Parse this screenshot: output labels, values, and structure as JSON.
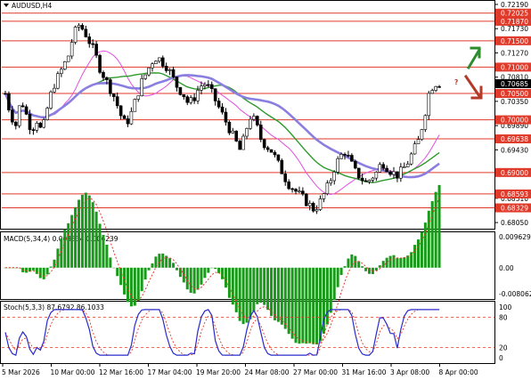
{
  "window": {
    "symbol_label": "AUDUSD,H4"
  },
  "main_panel": {
    "ylim": [
      0.6795,
      0.7224
    ],
    "price_axis_ticks": [
      "0.72190",
      "0.71730",
      "0.71270",
      "0.70810",
      "0.70350",
      "0.69890",
      "0.69430",
      "0.68970",
      "0.68510",
      "0.68050"
    ],
    "levels": [
      {
        "value": 0.72025,
        "label": "0.72025",
        "badge": true
      },
      {
        "value": 0.7187,
        "label": "0.71870",
        "badge": true
      },
      {
        "value": 0.715,
        "label": "0.71500",
        "badge": true
      },
      {
        "value": 0.71,
        "label": "0.71000",
        "badge": true
      },
      {
        "value": 0.705,
        "label": "0.70500",
        "badge": true
      },
      {
        "value": 0.7,
        "label": "0.70000",
        "badge": true
      },
      {
        "value": 0.69638,
        "label": "0.69638",
        "badge": true
      },
      {
        "value": 0.69,
        "label": "0.69000",
        "badge": true
      },
      {
        "value": 0.68593,
        "label": "0.68593",
        "badge": true
      },
      {
        "value": 0.68329,
        "label": "0.68329",
        "badge": true
      }
    ],
    "current_price": {
      "value": 0.70685,
      "label": "0.70685"
    },
    "forecast_marks": {
      "question_mark": "?",
      "up_arrow_color": "#2e8b2e",
      "down_arrow_color": "#b33a2a"
    }
  },
  "macd_panel": {
    "title": "MACD(5,34,4) 0.008834 0.006239",
    "ticks": [
      "0.009629",
      "0.00",
      "-0.008062"
    ],
    "ylim": [
      -0.0095,
      0.0105
    ]
  },
  "stoch_panel": {
    "title": "Stoch(5,3,3) 87.6792 86.1033",
    "ticks": [
      "100",
      "80",
      "20",
      "0"
    ],
    "levels": [
      80,
      20
    ]
  },
  "time_axis": {
    "labels": [
      "5 Mar 2026",
      "10 Mar 00:00",
      "12 Mar 16:00",
      "17 Mar 04:00",
      "19 Mar 20:00",
      "24 Mar 08:00",
      "27 Mar 00:00",
      "31 Mar 16:00",
      "3 Apr 08:00",
      "8 Apr 00:00"
    ]
  },
  "colors": {
    "bull_candle": "#ffffff",
    "bear_candle": "#000000",
    "level_line": "#e03a2a",
    "badge_bg": "#e03a2a",
    "current_badge_bg": "#000000",
    "ma_slow": "#8a7fe0",
    "ma_mid": "#2e9a2e",
    "ma_fast": "#e050e0",
    "macd_hist": "#1a9a1a",
    "macd_signal": "#e03a2a",
    "stoch_main": "#2b2bcc",
    "stoch_signal": "#e03a2a"
  },
  "chart_data": {
    "type": "candlestick",
    "title": "",
    "xlabel": "",
    "ylabel": "",
    "x_range": [
      "5 Mar 2026",
      "8 Apr 2026"
    ],
    "ylim": [
      0.6795,
      0.7224
    ],
    "close_path": [
      0.705,
      0.701,
      0.699,
      0.704,
      0.701,
      0.698,
      0.7,
      0.6975,
      0.702,
      0.706,
      0.708,
      0.71,
      0.712,
      0.716,
      0.718,
      0.717,
      0.715,
      0.713,
      0.71,
      0.708,
      0.706,
      0.704,
      0.701,
      0.699,
      0.701,
      0.704,
      0.707,
      0.709,
      0.711,
      0.712,
      0.711,
      0.71,
      0.708,
      0.706,
      0.705,
      0.703,
      0.704,
      0.706,
      0.707,
      0.706,
      0.704,
      0.702,
      0.7,
      0.698,
      0.696,
      0.694,
      0.698,
      0.701,
      0.699,
      0.696,
      0.695,
      0.694,
      0.692,
      0.69,
      0.688,
      0.687,
      0.686,
      0.685,
      0.684,
      0.683,
      0.684,
      0.686,
      0.688,
      0.691,
      0.693,
      0.694,
      0.692,
      0.69,
      0.689,
      0.688,
      0.689,
      0.69,
      0.692,
      0.691,
      0.69,
      0.6895,
      0.6905,
      0.692,
      0.694,
      0.696,
      0.7,
      0.705,
      0.707,
      0.70685
    ]
  }
}
